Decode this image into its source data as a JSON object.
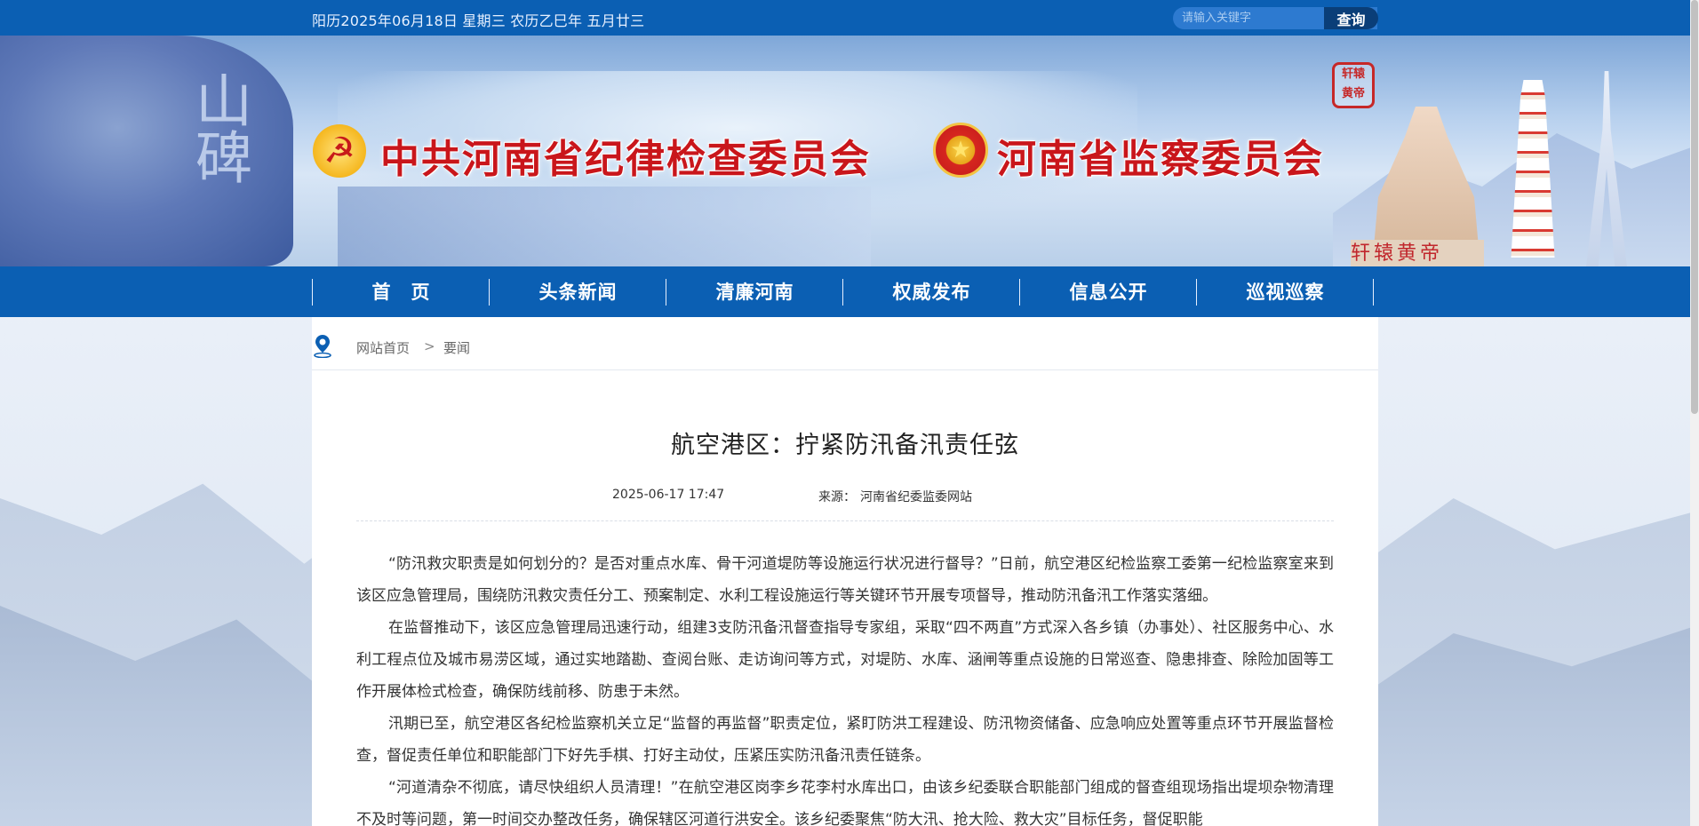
{
  "topbar": {
    "date_text": "阳历2025年06月18日 星期三 农历乙巳年 五月廿三",
    "search_placeholder": "请输入关键字",
    "search_button": "查询"
  },
  "banner": {
    "title_left": "中共河南省纪律检查委员会",
    "title_right": "河南省监察委员会",
    "party_emblem_icon": "party-emblem-icon",
    "state_emblem_icon": "national-emblem-icon",
    "seal_text": "轩辕黄帝",
    "statue_text": "轩辕黄帝",
    "cliff_text": "山碑"
  },
  "nav": {
    "items": [
      {
        "label": "首　页"
      },
      {
        "label": "头条新闻"
      },
      {
        "label": "清廉河南"
      },
      {
        "label": "权威发布"
      },
      {
        "label": "信息公开"
      },
      {
        "label": "巡视巡察"
      }
    ]
  },
  "breadcrumb": {
    "home": "网站首页",
    "separator": ">",
    "current": "要闻"
  },
  "article": {
    "title": "航空港区：拧紧防汛备汛责任弦",
    "date": "2025-06-17 17:47",
    "source_label": "来源：",
    "source": "河南省纪委监委网站",
    "paragraphs": [
      "“防汛救灾职责是如何划分的？是否对重点水库、骨干河道堤防等设施运行状况进行督导？”日前，航空港区纪检监察工委第一纪检监察室来到该区应急管理局，围绕防汛救灾责任分工、预案制定、水利工程设施运行等关键环节开展专项督导，推动防汛备汛工作落实落细。",
      "在监督推动下，该区应急管理局迅速行动，组建3支防汛备汛督查指导专家组，采取“四不两直”方式深入各乡镇（办事处）、社区服务中心、水利工程点位及城市易涝区域，通过实地踏勘、查阅台账、走访询问等方式，对堤防、水库、涵闸等重点设施的日常巡查、隐患排查、除险加固等工作开展体检式检查，确保防线前移、防患于未然。",
      "汛期已至，航空港区各纪检监察机关立足“监督的再监督”职责定位，紧盯防洪工程建设、防汛物资储备、应急响应处置等重点环节开展监督检查，督促责任单位和职能部门下好先手棋、打好主动仗，压紧压实防汛备汛责任链条。",
      "“河道清杂不彻底，请尽快组织人员清理！”在航空港区岗李乡花李村水库出口，由该乡纪委联合职能部门组成的督查组现场指出堤坝杂物清理不及时等问题，第一时间交办整改任务，确保辖区河道行洪安全。该乡纪委聚焦“防大汛、抢大险、救大灾”目标任务，督促职能"
    ]
  },
  "colors": {
    "primary_blue": "#0b5fb3",
    "title_red": "#c9161b"
  }
}
